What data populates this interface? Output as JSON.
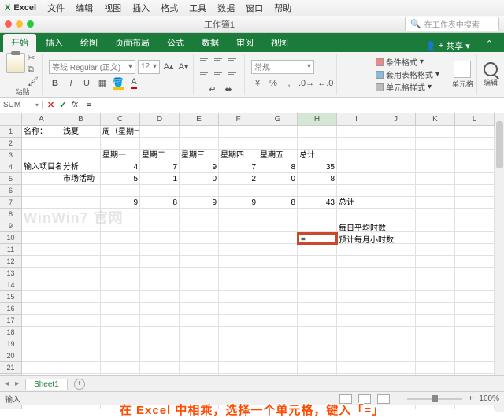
{
  "menubar": {
    "app": "Excel",
    "items": [
      "文件",
      "编辑",
      "视图",
      "插入",
      "格式",
      "工具",
      "数据",
      "窗口",
      "帮助"
    ]
  },
  "titlebar": {
    "title": "工作簿1",
    "search_placeholder": "在工作表中搜索"
  },
  "ribbon": {
    "tabs": [
      "开始",
      "插入",
      "绘图",
      "页面布局",
      "公式",
      "数据",
      "审阅",
      "视图"
    ],
    "share": "共享",
    "paste": "粘贴",
    "font_name": "等线 Regular (正文)",
    "font_size": "12",
    "number_format": "常规",
    "cond_format": "条件格式",
    "table_format": "套用表格格式",
    "cell_style": "单元格样式",
    "cells": "单元格",
    "editing": "编辑"
  },
  "formula": {
    "name_box": "SUM",
    "fx": "fx",
    "value": "="
  },
  "cols": [
    "A",
    "B",
    "C",
    "D",
    "E",
    "F",
    "G",
    "H",
    "I",
    "J",
    "K",
    "L"
  ],
  "selected_col": "H",
  "active_cell_value": "=",
  "cells": {
    "r1": {
      "A": "名称：",
      "B": "浅夏",
      "C": "周（星期一）"
    },
    "r3": {
      "C": "星期一",
      "D": "星期二",
      "E": "星期三",
      "F": "星期四",
      "G": "星期五",
      "H": "总计"
    },
    "r4": {
      "A": "输入项目名称：",
      "B": "分析",
      "C": "4",
      "D": "7",
      "E": "9",
      "F": "7",
      "G": "8",
      "H": "35"
    },
    "r5": {
      "B": "市场活动",
      "C": "5",
      "D": "1",
      "E": "0",
      "F": "2",
      "G": "0",
      "H": "8"
    },
    "r7": {
      "C": "9",
      "D": "8",
      "E": "9",
      "F": "9",
      "G": "8",
      "H": "43",
      "I": "总计"
    },
    "r8": {
      "I": "每日平均时数"
    },
    "r9": {
      "I": "预计每月小时数"
    }
  },
  "sheet_tab": "Sheet1",
  "status": {
    "mode": "输入",
    "zoom": "100%"
  },
  "caption": "在 Excel 中相乘，选择一个单元格，键入「=」",
  "watermark": "WinWin7 官网"
}
